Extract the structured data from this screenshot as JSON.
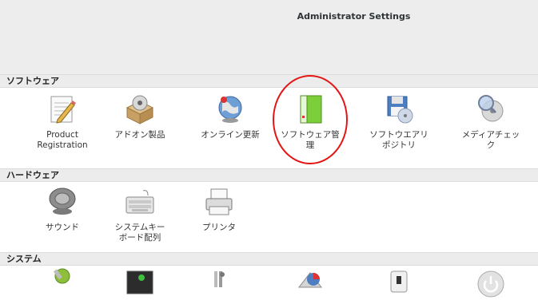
{
  "window": {
    "title": "Administrator Settings"
  },
  "sections": {
    "software": {
      "label": "ソフトウェア",
      "items": [
        {
          "label": "Product\nRegistration",
          "icon": "document-pencil-icon"
        },
        {
          "label": "アドオン製品",
          "icon": "package-box-icon"
        },
        {
          "label": "オンライン更新",
          "icon": "globe-update-icon"
        },
        {
          "label": "ソフトウェア管\n理",
          "icon": "green-package-icon"
        },
        {
          "label": "ソフトウエアリ\nポジトリ",
          "icon": "floppy-disk-icon"
        },
        {
          "label": "メディアチェッ\nク",
          "icon": "media-check-icon"
        }
      ]
    },
    "hardware": {
      "label": "ハードウェア",
      "items": [
        {
          "label": "サウンド",
          "icon": "speaker-icon"
        },
        {
          "label": "システムキー\nボード配列",
          "icon": "keyboard-icon"
        },
        {
          "label": "プリンタ",
          "icon": "printer-icon"
        }
      ]
    },
    "system": {
      "label": "システム",
      "items": [
        {
          "icon": "system-tools-icon"
        },
        {
          "icon": "terminal-monitor-icon"
        },
        {
          "icon": "boot-loader-icon"
        },
        {
          "icon": "partitioner-icon"
        },
        {
          "icon": "usb-device-icon"
        },
        {
          "icon": "power-icon"
        }
      ]
    }
  },
  "annotation": {
    "color": "#e41414"
  }
}
